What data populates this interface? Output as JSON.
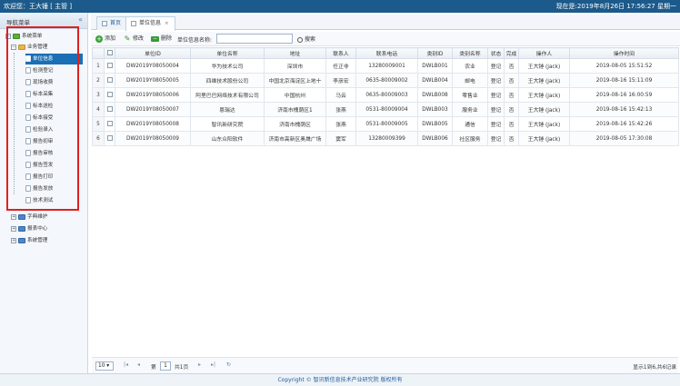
{
  "header": {
    "welcome": "欢迎您：王大锤 [ 主管 ]",
    "datetime": "现在是:2019年8月26日 17:56:27 星期一"
  },
  "sidebar": {
    "title": "导航菜单",
    "collapse_glyph": "«",
    "root": "系统菜单",
    "business": "业务管理",
    "business_items": [
      "单位信息",
      "检测登记",
      "现场收费",
      "标本采集",
      "标本送检",
      "标本接受",
      "检验录入",
      "报告初审",
      "报告审核",
      "报告签发",
      "报告打印",
      "报告发放",
      "技术测试"
    ],
    "active_index": 0,
    "bottom_items": [
      "字典维护",
      "报表中心",
      "系统管理"
    ]
  },
  "tabs": [
    {
      "label": "首页",
      "closable": false
    },
    {
      "label": "单位信息",
      "closable": true
    }
  ],
  "toolbar": {
    "add": "添加",
    "edit": "修改",
    "delete": "删除",
    "search_label": "单位信息名称:",
    "search_value": "",
    "search_btn": "搜索"
  },
  "grid": {
    "columns": [
      "单位ID",
      "单位名称",
      "地址",
      "联系人",
      "联系电话",
      "类别ID",
      "类别名称",
      "状态",
      "完成",
      "操作人",
      "操作时间"
    ],
    "rows": [
      [
        "1",
        "DW2019Y08050004",
        "华为技术公司",
        "深圳市",
        "任正非",
        "13280009001",
        "DWLB001",
        "农业",
        "登记",
        "否",
        "王大锤 (jack)",
        "2019-08-05 15:51:52"
      ],
      [
        "2",
        "DW2019Y08050005",
        "四维技术股份公司",
        "中国北京海淀区上地十",
        "李彦宏",
        "0635-80009002",
        "DWLB004",
        "邮电",
        "登记",
        "否",
        "王大锤 (jack)",
        "2019-08-16 15:11:09"
      ],
      [
        "3",
        "DW2019Y08050006",
        "阿里巴巴网络技术有限公司",
        "中国杭州",
        "马云",
        "0635-80009003",
        "DWLB008",
        "零售业",
        "登记",
        "否",
        "王大锤 (jack)",
        "2019-08-16 16:00:59"
      ],
      [
        "4",
        "DW2019Y08050007",
        "恩瑞达",
        "济南市槐荫区1",
        "张燕",
        "0531-80009004",
        "DWLB003",
        "服务业",
        "登记",
        "否",
        "王大锤 (jack)",
        "2019-08-16 15:42:13"
      ],
      [
        "5",
        "DW2019Y08050008",
        "智讯新研究院",
        "济南市槐荫区",
        "张燕",
        "0531-80009005",
        "DWLB005",
        "通信",
        "登记",
        "否",
        "王大锤 (jack)",
        "2019-08-16 15:42:26"
      ],
      [
        "6",
        "DW2019Y08050009",
        "山东众阳软件",
        "济南市高新区奥晟广场",
        "窦军",
        "13280009399",
        "DWLB006",
        "社区服务",
        "登记",
        "否",
        "王大锤 (jack)",
        "2019-08-05 17:30:08"
      ]
    ]
  },
  "pager": {
    "page_size": "10",
    "page_prefix": "第",
    "page_value": "1",
    "page_total": "共1页",
    "info": "显示1到6,共6记录"
  },
  "footer": "Copyright © 智讯新信息技术产业研究院 版权所有",
  "icons": {
    "first": "first-page-icon",
    "prev": "prev-page-icon",
    "next": "next-page-icon",
    "last": "last-page-icon",
    "refresh": "refresh-icon"
  },
  "colors": {
    "header_bg": "#1b5a8a",
    "active_item": "#1b6fb4",
    "highlight_box": "#e02020"
  }
}
